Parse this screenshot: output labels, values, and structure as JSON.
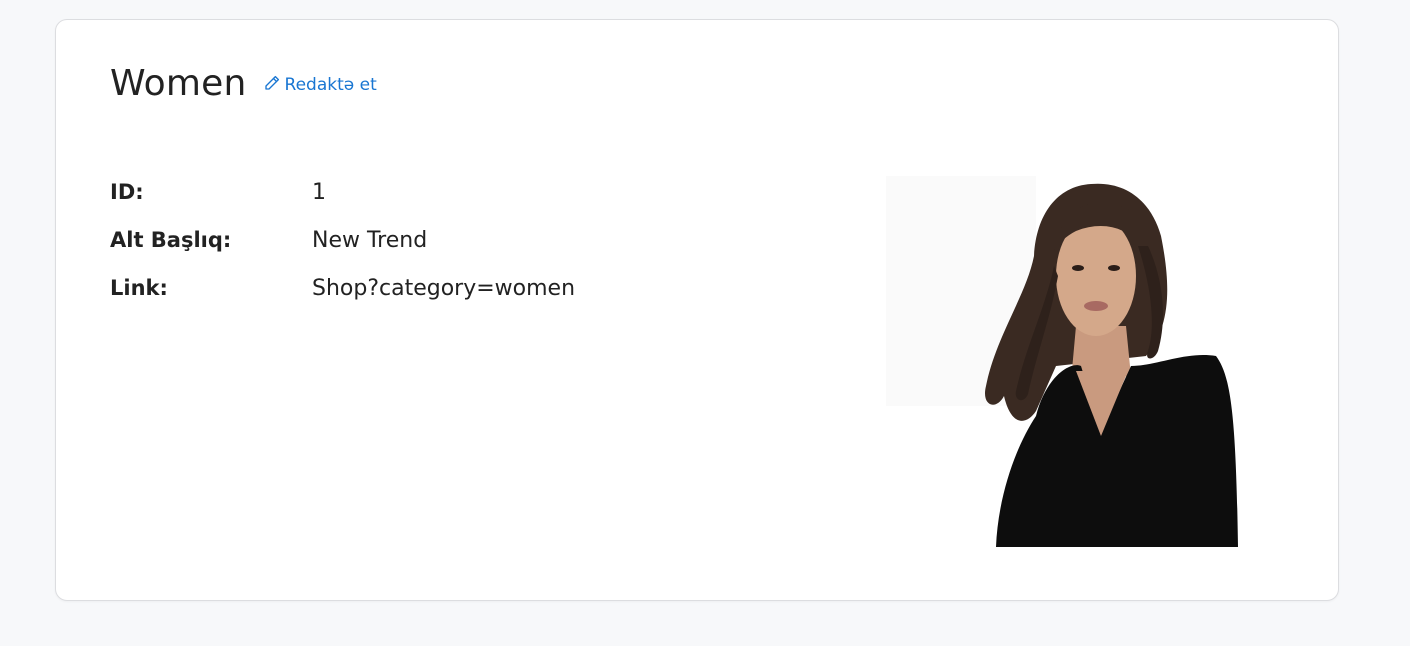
{
  "page": {
    "title": "Women",
    "edit_label": "Redaktə et"
  },
  "details": [
    {
      "label": "ID:",
      "value": "1"
    },
    {
      "label": "Alt Başlıq:",
      "value": "New Trend"
    },
    {
      "label": "Link:",
      "value": "Shop?category=women"
    }
  ],
  "colors": {
    "accent": "#1976d2",
    "background": "#f7f8fa",
    "card": "#ffffff"
  },
  "icons": {
    "edit": "pencil-icon"
  }
}
